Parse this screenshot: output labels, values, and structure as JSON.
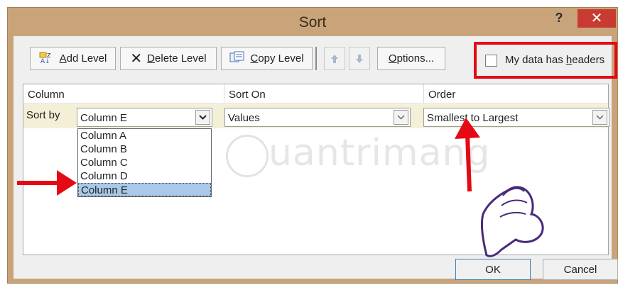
{
  "window": {
    "title": "Sort",
    "help_label": "?",
    "close_label": "✕"
  },
  "toolbar": {
    "add_level_mnemonic": "A",
    "add_level_rest": "dd Level",
    "delete_level_mnemonic": "D",
    "delete_level_rest": "elete Level",
    "copy_level_mnemonic": "C",
    "copy_level_rest": "opy Level",
    "options_mnemonic": "O",
    "options_rest": "ptions..."
  },
  "headers_checkbox": {
    "label_pre": "My data has ",
    "label_mnemonic": "h",
    "label_post": "eaders",
    "checked": false
  },
  "grid": {
    "columns": [
      "Column",
      "Sort On",
      "Order"
    ],
    "row": {
      "label": "Sort by",
      "column_value": "Column E",
      "sort_on_value": "Values",
      "order_value": "Smallest to Largest"
    },
    "column_options": [
      "Column A",
      "Column B",
      "Column C",
      "Column D",
      "Column E"
    ],
    "selected_option": "Column E"
  },
  "buttons": {
    "ok": "OK",
    "cancel": "Cancel"
  },
  "watermark": "uantrimang",
  "colors": {
    "title_bar": "#c9a47a",
    "close_button": "#c73b32",
    "highlight_box": "#e50914",
    "selection": "#a9c9ea",
    "row_tint": "#f4f0d8",
    "annotation_arrow": "#e50914"
  }
}
